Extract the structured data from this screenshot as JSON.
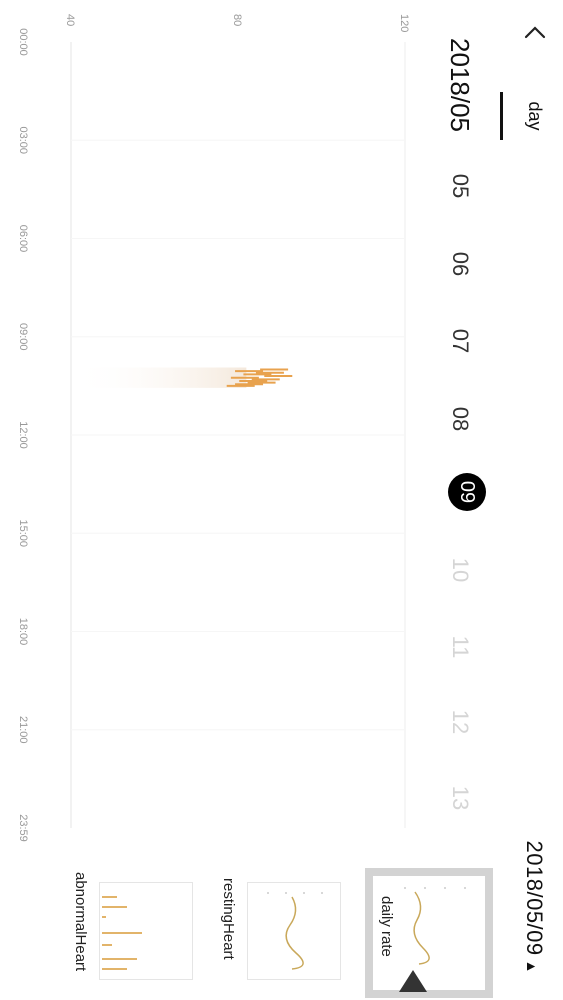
{
  "header": {
    "tab_day": "day",
    "current_date": "2018/05/09",
    "date_arrow": "▲"
  },
  "date_strip": {
    "month_label": "2018/05",
    "days": [
      {
        "label": "05",
        "state": "past"
      },
      {
        "label": "06",
        "state": "past"
      },
      {
        "label": "07",
        "state": "past"
      },
      {
        "label": "08",
        "state": "past"
      },
      {
        "label": "09",
        "state": "selected"
      },
      {
        "label": "10",
        "state": "future"
      },
      {
        "label": "11",
        "state": "future"
      },
      {
        "label": "12",
        "state": "future"
      },
      {
        "label": "13",
        "state": "future"
      }
    ]
  },
  "chart_data": {
    "type": "bar",
    "y_ticks": [
      "40",
      "80",
      "120"
    ],
    "ylim": [
      40,
      120
    ],
    "x_ticks": [
      "00:00",
      "03:00",
      "06:00",
      "09:00",
      "12:00",
      "15:00",
      "18:00",
      "21:00",
      "23:59"
    ],
    "xlim_hours": [
      0,
      24
    ],
    "bar_color": "#e8a24e",
    "points": [
      {
        "hour": 10.0,
        "value": 92
      },
      {
        "hour": 10.05,
        "value": 86
      },
      {
        "hour": 10.1,
        "value": 91
      },
      {
        "hour": 10.15,
        "value": 88
      },
      {
        "hour": 10.2,
        "value": 93
      },
      {
        "hour": 10.25,
        "value": 85
      },
      {
        "hour": 10.3,
        "value": 90
      },
      {
        "hour": 10.35,
        "value": 87
      },
      {
        "hour": 10.4,
        "value": 89
      },
      {
        "hour": 10.45,
        "value": 86
      },
      {
        "hour": 10.5,
        "value": 84
      }
    ]
  },
  "thumbnails": [
    {
      "label": "daily rate",
      "active": true
    },
    {
      "label": "restingHeart",
      "active": false
    },
    {
      "label": "abnormalHeart",
      "active": false
    }
  ]
}
